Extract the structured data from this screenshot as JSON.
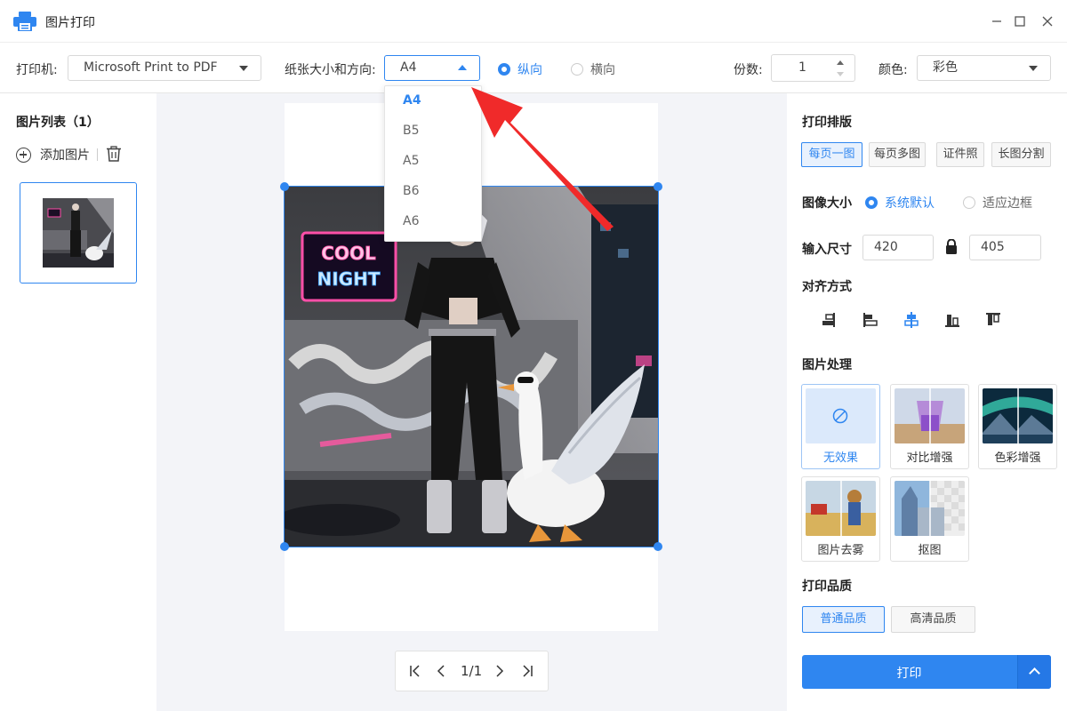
{
  "window": {
    "title": "图片打印",
    "controls": [
      "minimize",
      "maximize",
      "close"
    ]
  },
  "toolbar": {
    "printer_label": "打印机:",
    "printer_value": "Microsoft Print to PDF",
    "paper_label": "纸张大小和方向:",
    "paper_value": "A4",
    "orientation_portrait": "纵向",
    "orientation_landscape": "横向",
    "orientation_selected": "纵向",
    "copies_label": "份数:",
    "copies_value": "1",
    "color_label": "颜色:",
    "color_value": "彩色"
  },
  "paper_dropdown": {
    "options": [
      "A4",
      "B5",
      "A5",
      "B6",
      "A6"
    ],
    "selected": "A4"
  },
  "left_panel": {
    "title": "图片列表（1）",
    "add_label": "添加图片"
  },
  "canvas": {
    "neon_sign_line1": "COOL",
    "neon_sign_line2": "NIGHT",
    "pager_text": "1/1"
  },
  "right_panel": {
    "layout_title": "打印排版",
    "layout_options": [
      "每页一图",
      "每页多图",
      "证件照",
      "长图分割"
    ],
    "layout_selected": "每页一图",
    "size_title": "图像大小",
    "size_options": [
      "系统默认",
      "适应边框"
    ],
    "size_selected": "系统默认",
    "dimension_title": "输入尺寸",
    "width_value": "420",
    "height_value": "405",
    "align_title": "对齐方式",
    "align_icons": [
      "align-left-icon",
      "align-top-left-icon",
      "align-center-icon",
      "align-bottom-icon",
      "align-top-icon"
    ],
    "align_selected": "align-center-icon",
    "effects_title": "图片处理",
    "effects": [
      "无效果",
      "对比增强",
      "色彩增强",
      "图片去雾",
      "抠图"
    ],
    "effect_selected": "无效果",
    "quality_title": "打印品质",
    "quality_options": [
      "普通品质",
      "高清品质"
    ],
    "quality_selected": "普通品质",
    "print_label": "打印"
  },
  "colors": {
    "accent": "#2f86f0",
    "canvas_bg": "#f3f4f8"
  }
}
